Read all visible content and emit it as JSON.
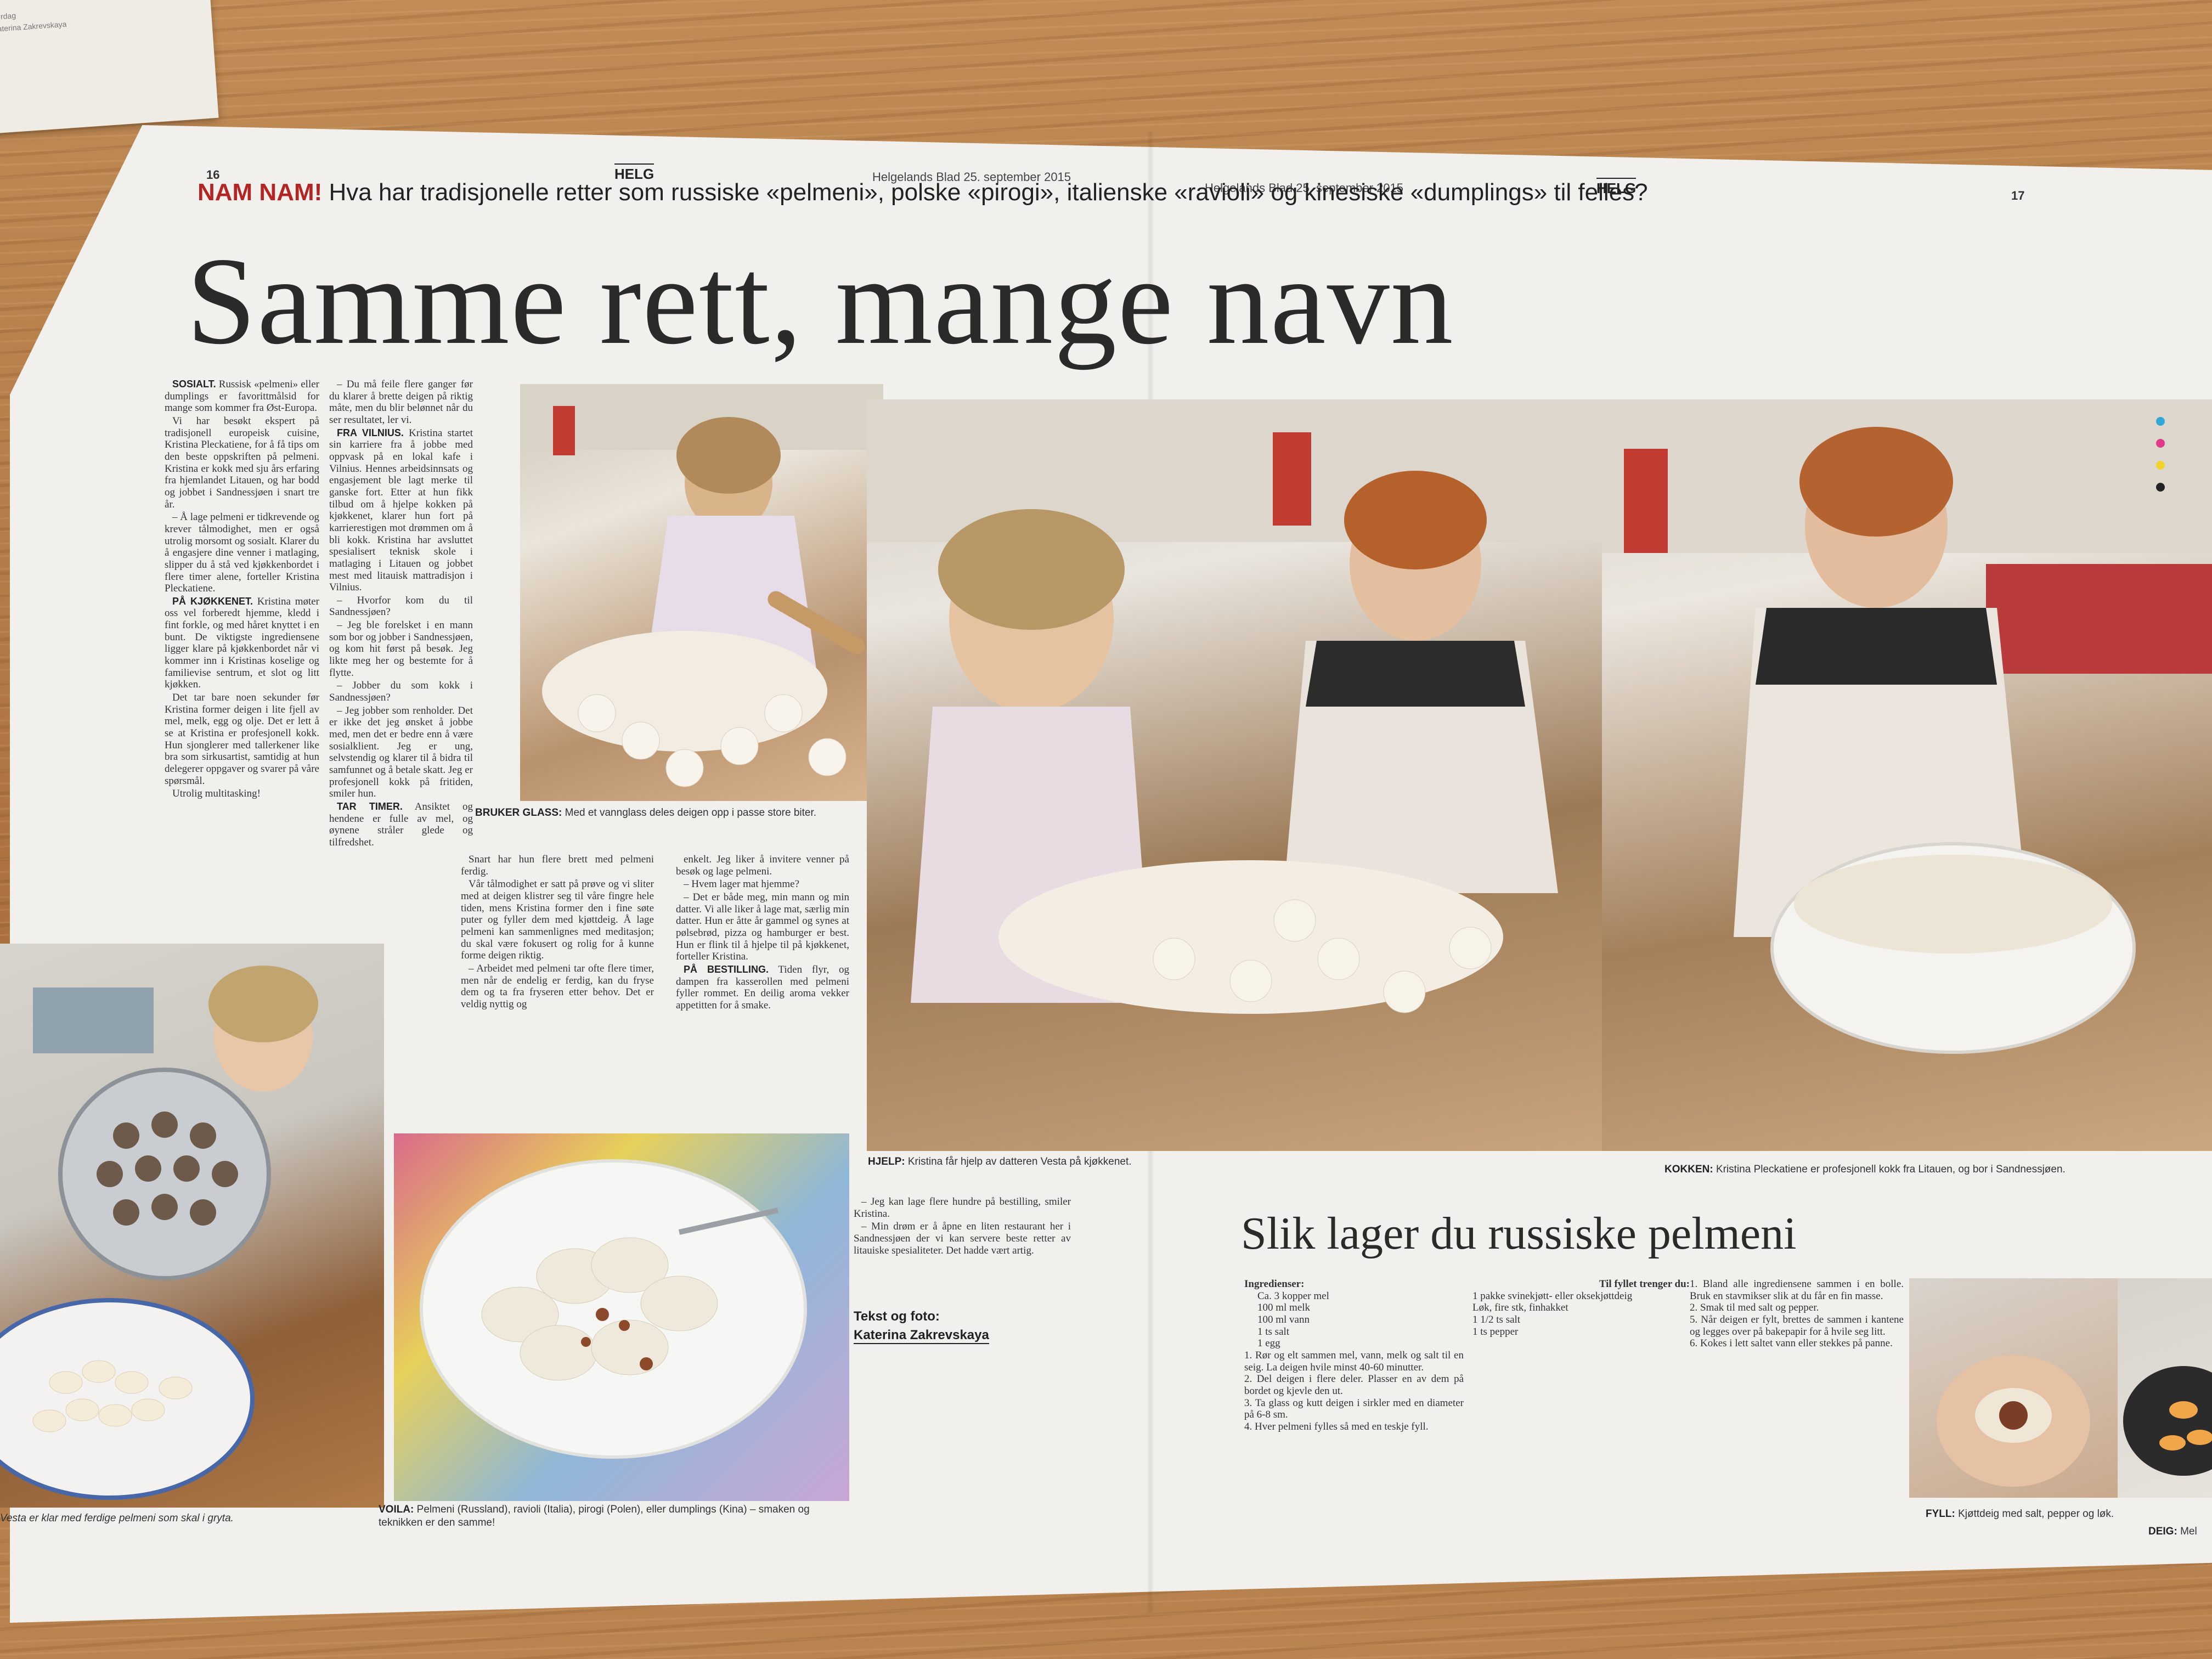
{
  "scrap": {
    "lines": [
      "Lørdag",
      "Katerina Zakrevskaya"
    ]
  },
  "header": {
    "left_page_number": "16",
    "right_page_number": "17",
    "section": "HELG",
    "left_dateline": "Helgelands Blad 25. september 2015",
    "right_dateline": "Helgelands Blad 25. september 2015"
  },
  "kicker": {
    "label": "NAM NAM!",
    "text": "Hva har tradisjonelle retter som russiske «pelmeni», polske «pirogi», italienske «ravioli» og kinesiske «dumplings» til felles?"
  },
  "headline": "Samme rett, mange navn",
  "article": {
    "col1": [
      {
        "lead": "SOSIALT.",
        "text": "Russisk «pelmeni» eller dumplings er favorittmålsid for mange som kommer fra Øst-Europa."
      },
      {
        "text": "Vi har besøkt ekspert på tradisjonell europeisk cuisine, Kristina Pleckatiene, for å få tips om den beste oppskriften på pelmeni. Kristina er kokk med sju års erfaring fra hjemlandet Litauen, og har bodd og jobbet i Sandnessjøen i snart tre år."
      },
      {
        "text": "– Å lage pelmeni er tidkrevende og krever tålmodighet, men er også utrolig morsomt og sosialt. Klarer du å engasjere dine venner i matlaging, slipper du å stå ved kjøkkenbordet i flere timer alene, forteller Kristina Pleckatiene."
      },
      {
        "lead": "PÅ KJØKKENET.",
        "text": "Kristina møter oss vel forberedt hjemme, kledd i fint forkle, og med håret knyttet i en bunt. De viktigste ingrediensene ligger klare på kjøkkenbordet når vi kommer inn i Kristinas koselige og familievise sentrum, et slot og litt kjøkken."
      },
      {
        "text": "Det tar bare noen sekunder før Kristina former deigen i lite fjell av mel, melk, egg og olje. Det er lett å se at Kristina er profesjonell kokk. Hun sjonglerer med tallerkener like bra som sirkusartist, samtidig at hun delegerer oppgaver og svarer på våre spørsmål."
      },
      {
        "text": "Utrolig multitasking!"
      }
    ],
    "col2": [
      {
        "text": "– Du må feile flere ganger før du klarer å brette deigen på riktig måte, men du blir belønnet når du ser resultatet, ler vi."
      },
      {
        "lead": "FRA VILNIUS.",
        "text": "Kristina startet sin karriere fra å jobbe med oppvask på en lokal kafe i Vilnius. Hennes arbeidsinnsats og engasjement ble lagt merke til ganske fort. Etter at hun fikk tilbud om å hjelpe kokken på kjøkkenet, klarer hun fort på karrierestigen mot drømmen om å bli kokk. Kristina har avsluttet spesialisert teknisk skole i matlaging i Litauen og jobbet mest med litauisk mattradisjon i Vilnius."
      },
      {
        "text": "– Hvorfor kom du til Sandnessjøen?"
      },
      {
        "text": "– Jeg ble forelsket i en mann som bor og jobber i Sandnessjøen, og kom hit først på besøk. Jeg likte meg her og bestemte for å flytte."
      },
      {
        "text": "– Jobber du som kokk i Sandnessjøen?"
      },
      {
        "text": "– Jeg jobber som renholder. Det er ikke det jeg ønsket å jobbe med, men det er bedre enn å være sosialklient. Jeg er ung, selvstendig og klarer til å bidra til samfunnet og å betale skatt. Jeg er profesjonell kokk på fritiden, smiler hun."
      },
      {
        "lead": "TAR TIMER.",
        "text": "Ansiktet og hendene er fulle av mel, og øynene stråler glede og tilfredshet."
      }
    ],
    "col3": [
      {
        "text": "Snart har hun flere brett med pelmeni ferdig."
      },
      {
        "text": "Vår tålmodighet er satt på prøve og vi sliter med at deigen klistrer seg til våre fingre hele tiden, mens Kristina former den i fine søte puter og fyller dem med kjøttdeig. Å lage pelmeni kan sammenlignes med meditasjon; du skal være fokusert og rolig for å kunne forme deigen riktig."
      },
      {
        "text": "– Arbeidet med pelmeni tar ofte flere timer, men når de endelig er ferdig, kan du fryse dem og ta fra fryseren etter behov. Det er veldig nyttig og"
      }
    ],
    "col4": [
      {
        "text": "enkelt. Jeg liker å invitere venner på besøk og lage pelmeni."
      },
      {
        "text": "– Hvem lager mat hjemme?"
      },
      {
        "text": "– Det er både meg, min mann og min datter. Vi alle liker å lage mat, særlig min datter. Hun er åtte år gammel og synes at pølsebrød, pizza og hamburger er best. Hun er flink til å hjelpe til på kjøkkenet, forteller Kristina."
      },
      {
        "lead": "PÅ BESTILLING.",
        "text": "Tiden flyr, og dampen fra kasserollen med pelmeni fyller rommet. En deilig aroma vekker appetitten for å smake."
      }
    ],
    "col5": [
      {
        "text": "– Jeg kan lage flere hundre på bestilling, smiler Kristina."
      },
      {
        "text": "– Min drøm er å åpne en liten restaurant her i Sandnessjøen der vi kan servere beste retter av litauiske spesialiteter. Det hadde vært artig."
      }
    ],
    "byline_label": "Tekst og foto:",
    "byline_name": "Katerina Zakrevskaya"
  },
  "captions": {
    "glass_label": "BRUKER GLASS:",
    "glass_text": "Med et vannglass deles deigen opp i passe store biter.",
    "vesta_text": "Vesta er klar med ferdige pelmeni som skal i gryta.",
    "voila_label": "VOILA:",
    "voila_text": "Pelmeni (Russland), ravioli (Italia), pirogi (Polen), eller dumplings (Kina) – smaken og teknikken er den samme!",
    "hjelp_label": "HJELP:",
    "hjelp_text": "Kristina får hjelp av datteren Vesta på kjøkkenet.",
    "kokken_label": "KOKKEN:",
    "kokken_text": "Kristina Pleckatiene er profesjonell kokk fra Litauen, og bor i Sandnessjøen.",
    "fyll_label": "FYLL:",
    "fyll_text": "Kjøttdeig med salt, pepper og løk.",
    "deig_label": "DEIG:",
    "deig_text": "Mel"
  },
  "recipe": {
    "title": "Slik lager du russiske pelmeni",
    "ingredients_label": "Ingredienser:",
    "ingredients": [
      "Ca. 3 kopper mel",
      "100 ml melk",
      "100 ml vann",
      "1 ts salt",
      "1 egg"
    ],
    "steps_a": [
      "1. Rør og elt sammen mel, vann, melk og salt til en seig. La deigen hvile minst 40-60 minutter.",
      "2. Del deigen i flere deler. Plasser en av dem på bordet og kjevle den ut.",
      "3. Ta glass og kutt deigen i sirkler med en diameter på 6-8 sm.",
      "4. Hver pelmeni fylles så med en teskje fyll."
    ],
    "filling_label": "Til fyllet trenger du:",
    "filling": [
      "1 pakke svinekjøtt- eller oksekjøttdeig",
      "Løk, fire stk, finhakket",
      "1 1/2 ts salt",
      "1 ts pepper"
    ],
    "steps_b": [
      "1. Bland alle ingrediensene sammen i en bolle. Bruk en stavmikser slik at du får en fin masse.",
      "2. Smak til med salt og pepper.",
      "5. Når deigen er fylt, brettes de sammen i kantene og legges over på bakepapir for å hvile seg litt.",
      "6. Kokes i lett saltet vann eller stekkes på panne."
    ]
  },
  "colors": {
    "kicker_red": "#b32424",
    "paper": "#f2f0ec",
    "wood": "#b98550"
  }
}
